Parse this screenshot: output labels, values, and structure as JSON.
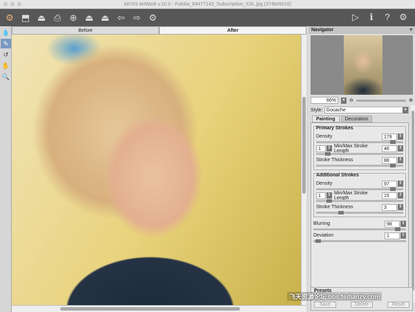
{
  "window": {
    "title": "AKVIS ArtWork v.10.0 - Fotolia_84477143_Subscription_XXL.jpg (3748x5616)"
  },
  "toolbar": {
    "left_icons": [
      "batch-icon",
      "open-icon",
      "save-icon",
      "print-icon",
      "share-icon",
      "export-icon",
      "import-icon",
      "back-icon",
      "forward-icon",
      "settings-gears-icon"
    ],
    "right_icons": [
      "run-icon",
      "info-icon",
      "help-icon",
      "preferences-icon"
    ]
  },
  "tools": [
    "dropper-icon",
    "brush-icon",
    "history-icon",
    "hand-icon",
    "zoom-icon"
  ],
  "view_tabs": {
    "before": "Before",
    "after": "After"
  },
  "navigator": {
    "title": "Navigator",
    "zoom": "66%"
  },
  "settings": {
    "style_label": "Style:",
    "style_value": "Gouache",
    "tabs": {
      "painting": "Painting",
      "decoration": "Decoration"
    },
    "primary": {
      "title": "Primary Strokes",
      "density_label": "Density",
      "density": "179",
      "length_label": "Min/Max Stroke Length",
      "length_min": "1",
      "length_max": "46",
      "thickness_label": "Stroke Thickness",
      "thickness": "88"
    },
    "additional": {
      "title": "Additional Strokes",
      "density_label": "Density",
      "density": "97",
      "length_label": "Min/Max Stroke Length",
      "length_min": "1",
      "length_max": "15",
      "thickness_label": "Stroke Thickness",
      "thickness": "3"
    },
    "blurring_label": "Blurring",
    "blurring": "98",
    "deviation_label": "Deviation",
    "deviation": "1"
  },
  "presets": {
    "title": "Presets",
    "save": "Save",
    "delete": "Delete",
    "reset": "Reset"
  },
  "watermark": "飞天资源论坛 bbs.feitianzy.com"
}
